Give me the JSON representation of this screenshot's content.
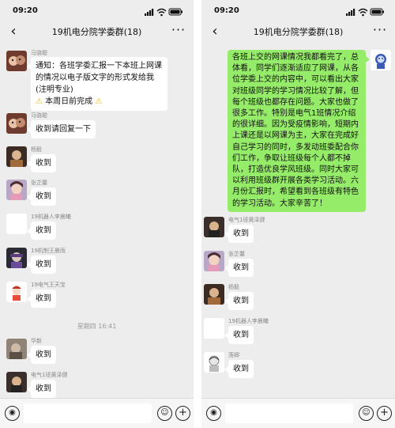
{
  "status": {
    "time": "09:20"
  },
  "chat": {
    "title": "19机电分院学委群(18)"
  },
  "left": {
    "messages": [
      {
        "sender": "马骁聪",
        "text": "通知：各班学委汇报一下本班上网课的情况以电子版文字的形式发给我(注明专业)"
      },
      {
        "sender": "马骁聪",
        "text": "收到请回复一下"
      },
      {
        "sender": "杨毅",
        "text": "收到"
      },
      {
        "sender": "张芷馨",
        "text": "收到"
      },
      {
        "sender": "19机器人李晨曦",
        "text": "收到"
      },
      {
        "sender": "19机制王晨雨",
        "text": "收到"
      },
      {
        "sender": "19电气王天宝",
        "text": "收到"
      },
      {
        "sender": "华新",
        "text": "收到"
      },
      {
        "sender": "电气1班黄泽健",
        "text": "收到"
      }
    ],
    "deadline": "本周日前完成",
    "timestamp": "星期四 16:41"
  },
  "right": {
    "long_message": "各班上交的网课情况我都看完了，总体看，同学们逐渐适应了网课，从各位学委上交的内容中，可以看出大家对班级同学的学习情况比较了解，但每个班级也都存在问题。大家也做了很多工作。特别是电气1班情况介绍的很详细。因为受疫情影响，短期内上课还是以网课为主，大家在完成好自己学习的同时，多发动班委配合你们工作，争取让班级每个人都不掉队，打造优良学风班级。同时大家可以利用班级群开展各类学习活动。六月份汇报时，希望看到各班级有特色的学习活动。大家辛苦了！",
    "messages": [
      {
        "sender": "电气1班黄泽健",
        "text": "收到"
      },
      {
        "sender": "张芷馨",
        "text": "收到"
      },
      {
        "sender": "杨毅",
        "text": "收到"
      },
      {
        "sender": "19机器人李晨曦",
        "text": "收到"
      },
      {
        "sender": "落卿",
        "text": "收到"
      }
    ]
  },
  "colors": {
    "chat_bg": "#ededed",
    "bubble_self": "#95ec69",
    "bubble_other": "#ffffff",
    "warning": "#f2b600"
  },
  "icons": [
    "back-arrow-icon",
    "more-icon",
    "signal-icon",
    "wifi-icon",
    "battery-icon",
    "voice-icon",
    "emoji-icon",
    "plus-icon",
    "warning-icon"
  ]
}
